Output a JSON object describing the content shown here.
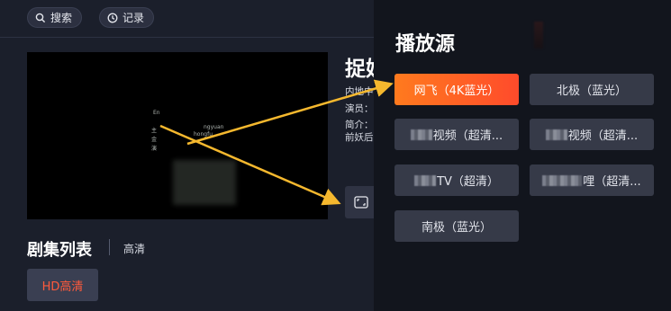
{
  "topbar": {
    "search_label": "搜索",
    "history_label": "记录"
  },
  "video": {
    "overlay_texts": [
      "En",
      "ngyuan",
      "hongfu",
      "主",
      "金",
      "演"
    ]
  },
  "details": {
    "title": "捉妖",
    "region_prefix": "内地中",
    "cast_label": "演员：",
    "intro_label": "简介：",
    "intro_text": "前妖后"
  },
  "episodes": {
    "title": "剧集列表",
    "quality": "高清",
    "item_label": "HD高清"
  },
  "panel": {
    "title": "播放源",
    "sources": [
      {
        "label": "网飞（4K蓝光）",
        "active": true
      },
      {
        "label": "北极（蓝光）",
        "active": false
      },
      {
        "label": "视频（超清...",
        "active": false,
        "prefix_masked": true
      },
      {
        "label": "视频（超清...",
        "active": false,
        "prefix_masked": true
      },
      {
        "label": "TV（超清）",
        "active": false,
        "prefix_masked": true
      },
      {
        "label": "哩（超清...",
        "active": false,
        "prefix_masked": true
      },
      {
        "label": "南极（蓝光）",
        "active": false
      }
    ]
  },
  "colors": {
    "accent_orange": "#ff5a2b",
    "arrow_yellow": "#f5b82e",
    "panel_bg": "#12151d",
    "page_bg": "#1b1f2b"
  }
}
